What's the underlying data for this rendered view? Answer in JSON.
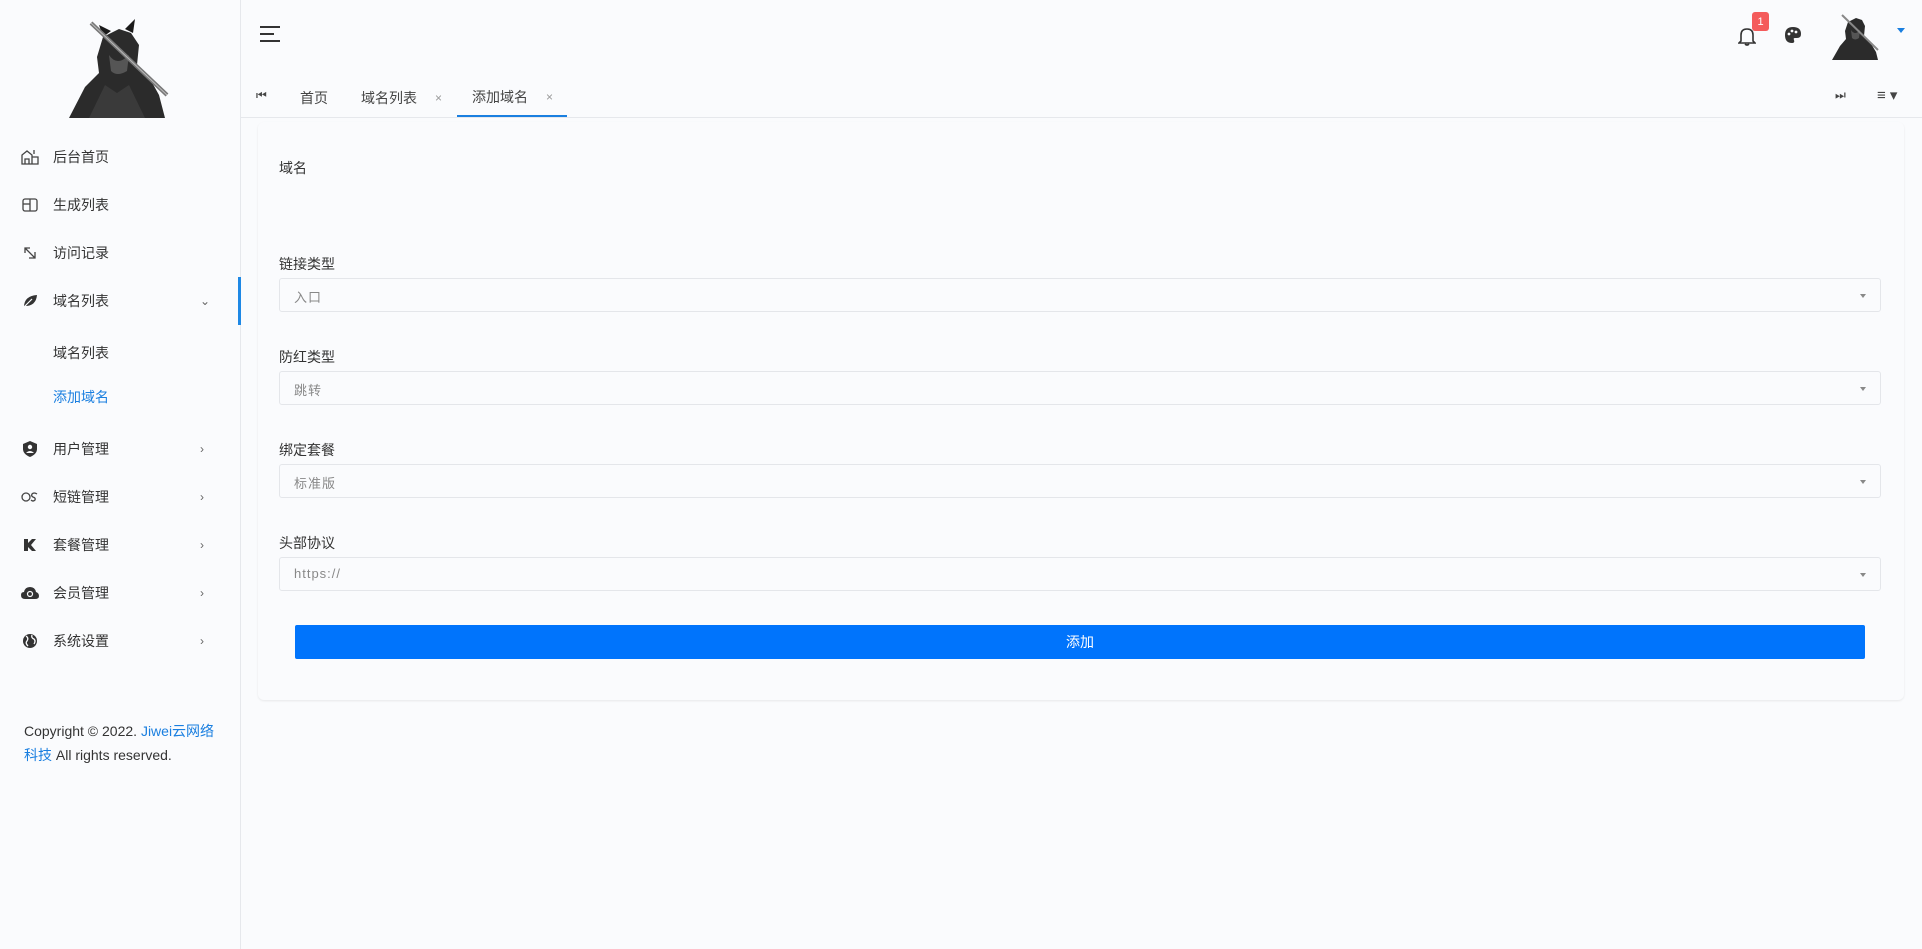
{
  "sidebar": {
    "menu": [
      {
        "label": "后台首页",
        "icon": "dashboard-icon"
      },
      {
        "label": "生成列表",
        "icon": "table-icon"
      },
      {
        "label": "访问记录",
        "icon": "arrow-icon"
      },
      {
        "label": "域名列表",
        "icon": "leaf-icon",
        "open": true,
        "children": [
          {
            "label": "域名列表"
          },
          {
            "label": "添加域名",
            "active": true
          }
        ]
      },
      {
        "label": "用户管理",
        "icon": "user-shield-icon"
      },
      {
        "label": "短链管理",
        "icon": "link-icon"
      },
      {
        "label": "套餐管理",
        "icon": "k-icon"
      },
      {
        "label": "会员管理",
        "icon": "cloud-icon"
      },
      {
        "label": "系统设置",
        "icon": "globe-icon"
      }
    ],
    "copyright": {
      "prefix": "Copyright © 2022. ",
      "link": "Jiwei云网络科技",
      "suffix": " All rights reserved."
    }
  },
  "header": {
    "notification_count": "1"
  },
  "tabs": [
    {
      "label": "首页",
      "closable": false
    },
    {
      "label": "域名列表",
      "closable": true
    },
    {
      "label": "添加域名",
      "closable": true,
      "active": true
    }
  ],
  "form": {
    "domain_label": "域名",
    "link_type_label": "链接类型",
    "link_type_value": "入口",
    "anti_red_label": "防红类型",
    "anti_red_value": "跳转",
    "package_label": "绑定套餐",
    "package_value": "标准版",
    "protocol_label": "头部协议",
    "protocol_value": "https://",
    "submit_label": "添加"
  },
  "colors": {
    "accent": "#1a7fe0",
    "button": "#0074fc",
    "badge": "#f45b5b"
  }
}
